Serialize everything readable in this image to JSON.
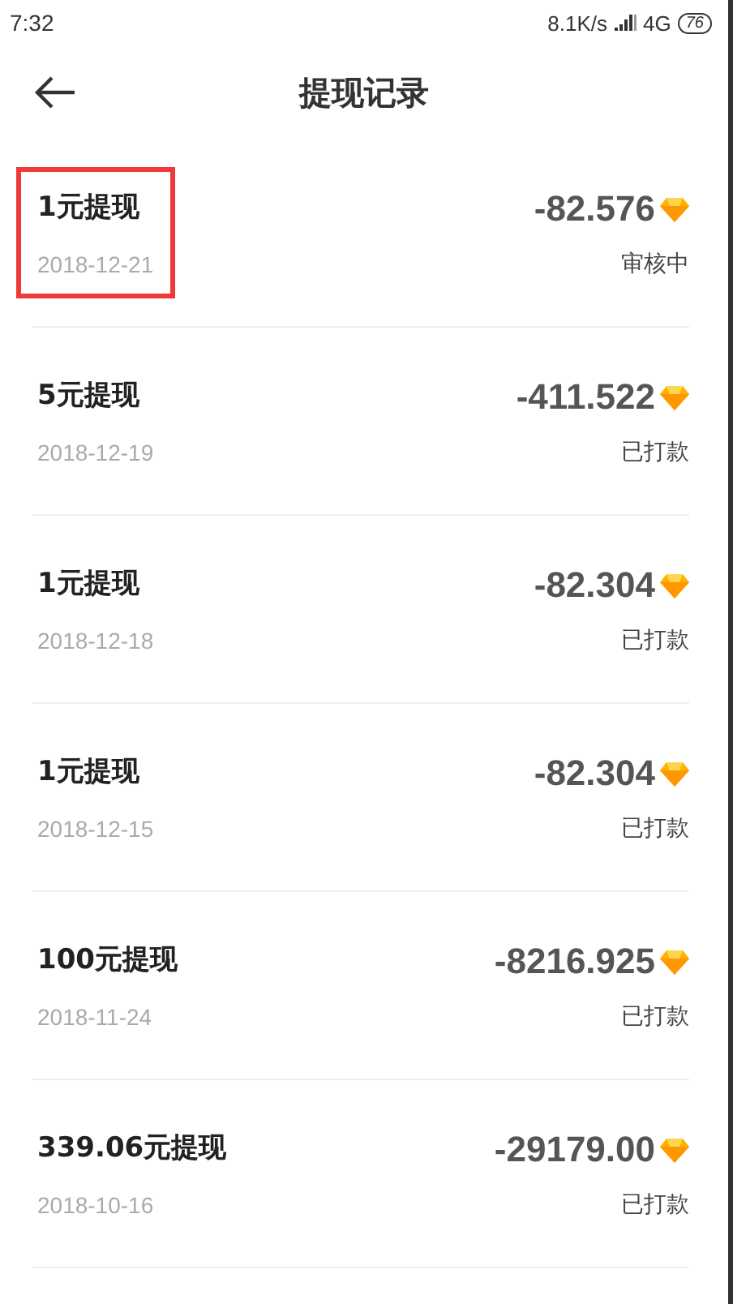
{
  "status_bar": {
    "time": "7:32",
    "speed": "8.1K/s",
    "network": "4G",
    "battery": "76"
  },
  "header": {
    "title": "提现记录"
  },
  "records": [
    {
      "title": "1元提现",
      "date": "2018-12-21",
      "amount": "-82.576",
      "status": "审核中",
      "highlighted": true
    },
    {
      "title": "5元提现",
      "date": "2018-12-19",
      "amount": "-411.522",
      "status": "已打款",
      "highlighted": false
    },
    {
      "title": "1元提现",
      "date": "2018-12-18",
      "amount": "-82.304",
      "status": "已打款",
      "highlighted": false
    },
    {
      "title": "1元提现",
      "date": "2018-12-15",
      "amount": "-82.304",
      "status": "已打款",
      "highlighted": false
    },
    {
      "title": "100元提现",
      "date": "2018-11-24",
      "amount": "-8216.925",
      "status": "已打款",
      "highlighted": false
    },
    {
      "title": "339.06元提现",
      "date": "2018-10-16",
      "amount": "-29179.00",
      "status": "已打款",
      "highlighted": false
    }
  ]
}
